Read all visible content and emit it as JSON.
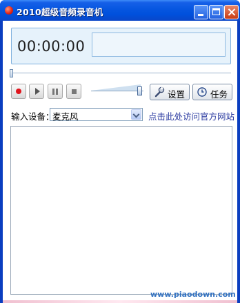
{
  "window": {
    "title": "2010超级音频录音机",
    "icon": "record-app-icon",
    "title_buttons": [
      "minimize",
      "maximize",
      "close"
    ]
  },
  "display": {
    "time": "00:00:00",
    "panel_color": "#e6f2fb"
  },
  "progress": {
    "position_fraction": 0.0
  },
  "controls": {
    "buttons": [
      "record",
      "play",
      "pause",
      "stop"
    ],
    "record_color": "#e0141c",
    "volume_fraction": 0.95
  },
  "actions": {
    "settings_label": "设置",
    "settings_icon": "wrench-icon",
    "tasks_label": "任务",
    "tasks_icon": "clock-icon"
  },
  "input": {
    "label": "输入设备：",
    "selected": "麦克风"
  },
  "link": {
    "text": "点击此处访问官方网站",
    "color": "#2a3aa0"
  },
  "log": {
    "watermark": "www.piaodown.com"
  },
  "colors": {
    "titlebar": "#0656e0",
    "frame": "#0a3ec0",
    "accent": "#3070c0"
  }
}
